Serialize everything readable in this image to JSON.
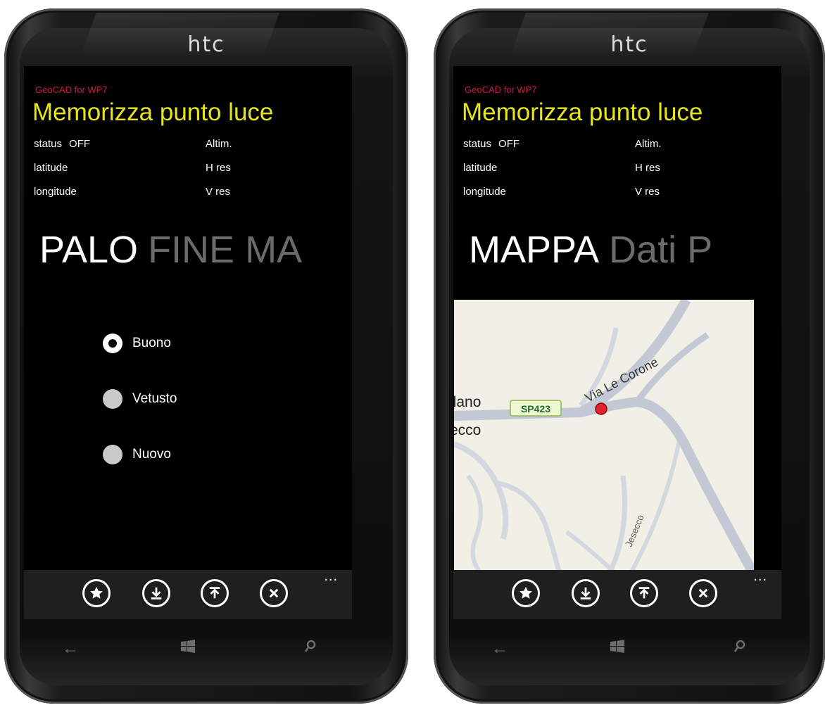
{
  "left_phone": {
    "brand": "htc",
    "app_title": "GeoCAD for WP7",
    "page_title": "Memorizza punto luce",
    "status_label": "status",
    "status_value": "OFF",
    "latitude_label": "latitude",
    "longitude_label": "longitude",
    "altim_label": "Altim.",
    "hres_label": "H res",
    "vres_label": "V res",
    "pivot_active": "PALO",
    "pivot_next": "FINE MA",
    "radios": [
      {
        "label": "Buono",
        "checked": true
      },
      {
        "label": "Vetusto",
        "checked": false
      },
      {
        "label": "Nuovo",
        "checked": false
      }
    ],
    "appbar_icons": [
      "star-icon",
      "download-icon",
      "upload-icon",
      "close-icon"
    ],
    "appbar_more": "..."
  },
  "right_phone": {
    "brand": "htc",
    "app_title": "GeoCAD for WP7",
    "page_title": "Memorizza punto luce",
    "status_label": "status",
    "status_value": "OFF",
    "latitude_label": "latitude",
    "longitude_label": "longitude",
    "altim_label": "Altim.",
    "hres_label": "H res",
    "vres_label": "V res",
    "pivot_active": "MAPPA",
    "pivot_next": "Dati P",
    "map": {
      "street_label": "Via Le Corone",
      "road_badge": "SP423",
      "place_fragment_1": "llano",
      "place_fragment_2": "ecco",
      "street_fragment": "Jesecco",
      "marker_color": "#e8202a"
    },
    "appbar_icons": [
      "star-icon",
      "download-icon",
      "upload-icon",
      "close-icon"
    ],
    "appbar_more": "..."
  },
  "colors": {
    "app_title": "#d0154a",
    "page_title": "#e7e51a",
    "pivot_inactive": "#6b6b6b",
    "appbar": "#1f1f1f"
  }
}
